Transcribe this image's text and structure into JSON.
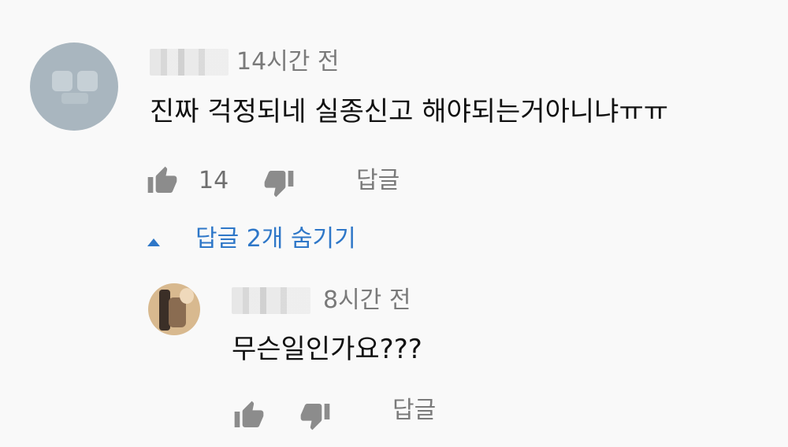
{
  "comment": {
    "time": "14시간 전",
    "text": "진짜 걱정되네 실종신고 해야되는거아니냐ㅠㅠ",
    "like_count": "14",
    "reply_label": "답글",
    "like_icon": "thumbs-up-icon",
    "dislike_icon": "thumbs-down-icon"
  },
  "replies_toggle": {
    "label": "답글 2개 숨기기",
    "icon": "caret-up-icon",
    "color": "#2e77c8"
  },
  "reply": {
    "time": "8시간 전",
    "text": "무슨일인가요???",
    "reply_label": "답글"
  }
}
